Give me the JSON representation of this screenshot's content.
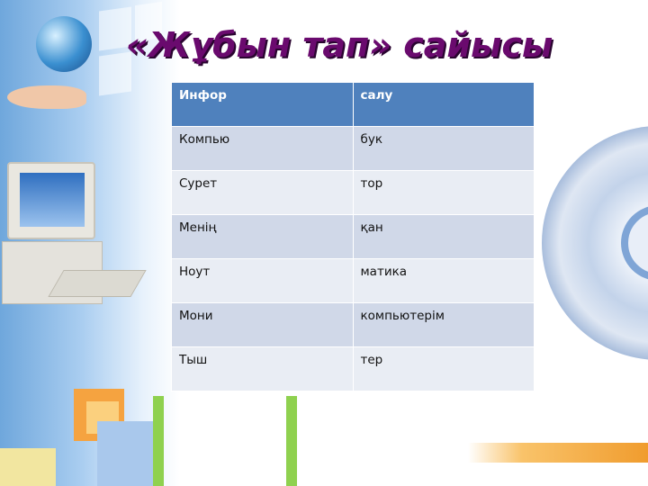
{
  "title": "«Жұбын тап» сайысы",
  "table": {
    "header": [
      "Инфор",
      "салу"
    ],
    "rows": [
      [
        "Компью",
        "бук"
      ],
      [
        "Сурет",
        "тор"
      ],
      [
        "Менің",
        "қан"
      ],
      [
        "Ноут",
        "матика"
      ],
      [
        "Мони",
        "компьютерім"
      ],
      [
        "Тыш",
        "тер"
      ]
    ]
  },
  "colors": {
    "title": "#6a0a6e",
    "header": "#4f81bd",
    "row_odd": "#d0d8e8",
    "row_even": "#e9edf4"
  }
}
